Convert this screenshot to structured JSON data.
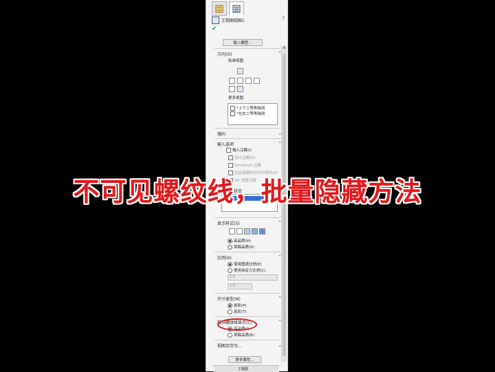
{
  "panel": {
    "title": "工程图视图1",
    "help_icon": "help-icon",
    "ok_icon": "check-icon",
    "import_button": "输入模型…",
    "orientation": {
      "header": "方向(O)",
      "standard_views_label": "标准视图",
      "more_views_label": "更多视图",
      "more_views_items": [
        "*上下二等角轴测",
        "*左右二等角轴测"
      ]
    },
    "mirror": {
      "header": "镜向"
    },
    "import_options": {
      "header": "输入选项",
      "items": [
        "输入注解(I)",
        "设计注解(D)",
        "DimXpert 注解",
        "包括隐藏特征中的项目(H)",
        "3D 视图注解"
      ]
    },
    "display_state": {
      "header": "显示状态",
      "selected": "显示状态-1"
    },
    "display_style": {
      "header": "显示样式(S)",
      "options": [
        "高品质(H)",
        "草稿品质(R)"
      ],
      "selected_index": 0
    },
    "scale": {
      "header": "比例(A)",
      "options": [
        "使用图纸比例(E)",
        "使用自定义比例(C)"
      ],
      "selected_index": 0,
      "value1": "1:5",
      "value2": "1:5"
    },
    "dimension_type": {
      "header": "尺寸类型(M)",
      "options": [
        "投影(P)",
        "真实(T)"
      ],
      "selected_index": 0
    },
    "thread_display": {
      "header": "装饰螺纹线显示(C)",
      "options": [
        "高品质(I)",
        "草稿品质(R)"
      ],
      "selected_index": 0
    },
    "save_view": {
      "header": "视图另存为..."
    },
    "more_props_button": "更多属性...",
    "bottom_tab": "工程图"
  },
  "banner_text": "不可见螺纹线，批量隐藏方法",
  "colors": {
    "banner": "#e4181c",
    "highlight_circle": "#e0191e",
    "selection": "#3b6fd6"
  }
}
